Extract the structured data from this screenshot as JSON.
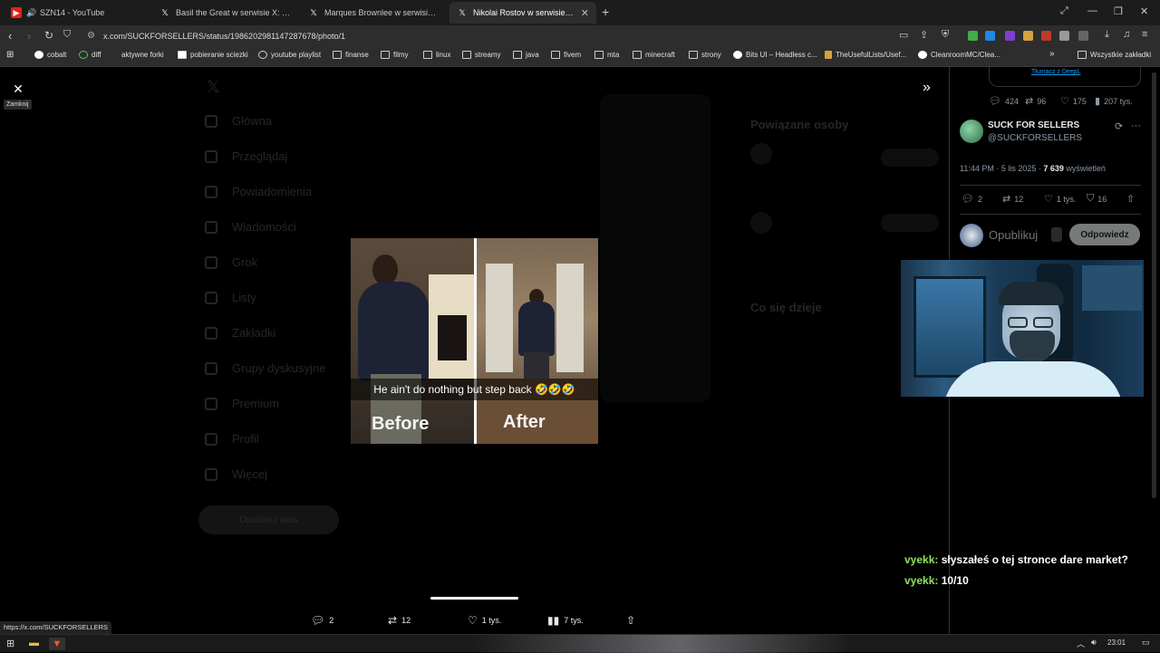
{
  "browser": {
    "tabs": [
      {
        "label": "SZN14 - YouTube",
        "icon": "youtube-icon"
      },
      {
        "label": "Basil the Great w serwisie X: „EU Pres",
        "icon": "x-icon"
      },
      {
        "label": "Marques Brownlee w serwisie X: „You",
        "icon": "x-icon"
      },
      {
        "label": "Nikolai Rostov w serwisie X: „go",
        "icon": "x-icon"
      }
    ],
    "url": "x.com/SUCKFORSELLERS/status/1986202981147287678/photo/1",
    "bookmarks": [
      "cobalt",
      "diff",
      "aktywne forki",
      "pobieranie sciezki",
      "youtube playlist",
      "finanse",
      "filmy",
      "linux",
      "streamy",
      "java",
      "fivem",
      "mta",
      "minecraft",
      "strony",
      "Bits UI – Headless c...",
      "TheUsefulLists/Usef...",
      "CleanroomMC/Clea..."
    ],
    "all_bookmarks": "Wszystkie zakładki",
    "status_url": "https://x.com/SUCKFORSELLERS",
    "clock": "23:01",
    "accent": "#1d9bf0"
  },
  "viewer": {
    "close_tooltip": "Zamknij",
    "caption": "He ain't do nothing but step back 🤣🤣🤣",
    "before": "Before",
    "after": "After",
    "actions": {
      "replies": "2",
      "reposts": "12",
      "likes": "1 tys.",
      "views": "7 tys."
    }
  },
  "background_nav": [
    "Główna",
    "Przeglądaj",
    "Powiadomienia",
    "Wiadomości",
    "Grok",
    "Listy",
    "Zakładki",
    "Grupy dyskusyjne",
    "Premium",
    "Profil",
    "Więcej"
  ],
  "background_post_button": "Opublikuj wpis",
  "background_right": {
    "related_title": "Powiązane osoby",
    "happening_title": "Co się dzieje",
    "follow_label": "Obserwuj"
  },
  "panel": {
    "translate_link": "Tłumacz z DeepL",
    "prev_stats": {
      "replies": "424",
      "reposts": "96",
      "likes": "175",
      "views": "207 tys."
    },
    "author": {
      "name": "SUCK FOR SELLERS",
      "handle": "@SUCKFORSELLERS"
    },
    "meta": {
      "time": "11:44 PM · 5 lis 2025 · ",
      "views_count": "7 639",
      "views_label": " wyświetleń"
    },
    "stats": {
      "replies": "2",
      "reposts": "12",
      "likes": "1 tys.",
      "bookmarks": "16"
    },
    "reply_placeholder": "Opublikuj",
    "reply_button": "Odpowiedz"
  },
  "chat": [
    {
      "user": "vyekk:",
      "message": "słyszałeś o tej stronce dare market?"
    },
    {
      "user": "vyekk:",
      "message": "10/10"
    }
  ]
}
